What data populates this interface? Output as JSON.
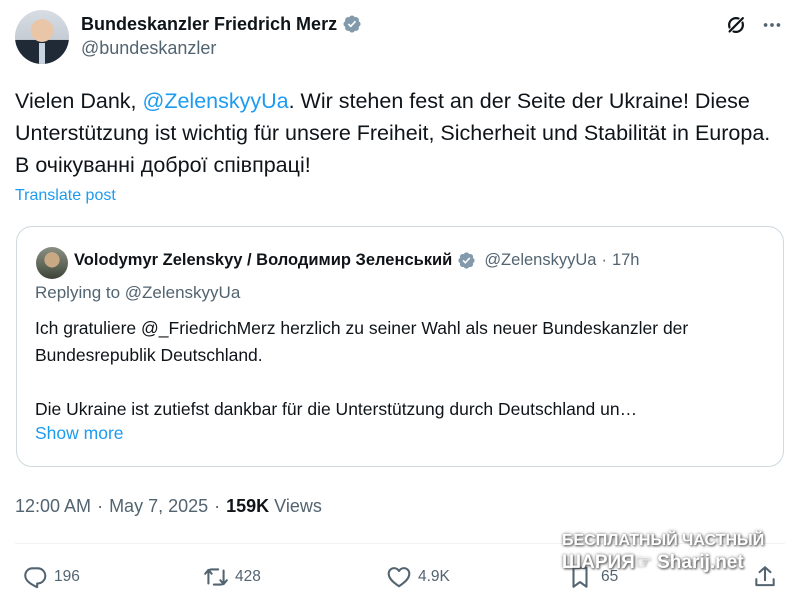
{
  "author": {
    "display_name": "Bundeskanzler Friedrich Merz",
    "handle": "@bundeskanzler"
  },
  "post": {
    "text_before": "Vielen Dank, ",
    "mention": "@ZelenskyyUa",
    "text_after": ". Wir stehen fest an der Seite der Ukraine! Diese Unterstützung ist wichtig für unsere Freiheit, Sicherheit und Stabilität in Europa. В очікуванні доброї співпраці!",
    "translate_label": "Translate post"
  },
  "quote": {
    "display_name": "Volodymyr Zelenskyy / Володимир Зеленський",
    "handle": "@ZelenskyyUa",
    "separator": "·",
    "time": "17h",
    "replying_to": "Replying to @ZelenskyyUa",
    "paragraph_1": "Ich gratuliere @_FriedrichMerz herzlich zu seiner Wahl als neuer Bundeskanzler der Bundesrepublik Deutschland.",
    "paragraph_2": "Die Ukraine ist zutiefst dankbar für die Unterstützung durch Deutschland un…",
    "show_more": "Show more"
  },
  "meta": {
    "time": "12:00 AM",
    "separator": "·",
    "date": "May 7, 2025",
    "views_count": "159K",
    "views_label": "Views"
  },
  "actions": {
    "replies": "196",
    "reposts": "428",
    "likes": "4.9K",
    "bookmarks": "65"
  },
  "watermark": {
    "line1": "БЕСПЛАТНЫЙ ЧАСТНЫЙ",
    "line2": "ШАРИЯ☞ Sharij.net"
  },
  "colors": {
    "accent": "#1d9bf0",
    "secondary_text": "#536471",
    "primary_text": "#0f1419",
    "border": "#cfd9de"
  },
  "icons": {
    "verified": "verified-badge-icon",
    "grok": "grok-icon",
    "more": "more-dots-icon",
    "reply": "reply-bubble-icon",
    "repost": "repost-arrows-icon",
    "like": "heart-icon",
    "bookmark": "bookmark-icon",
    "share": "share-upload-icon"
  }
}
